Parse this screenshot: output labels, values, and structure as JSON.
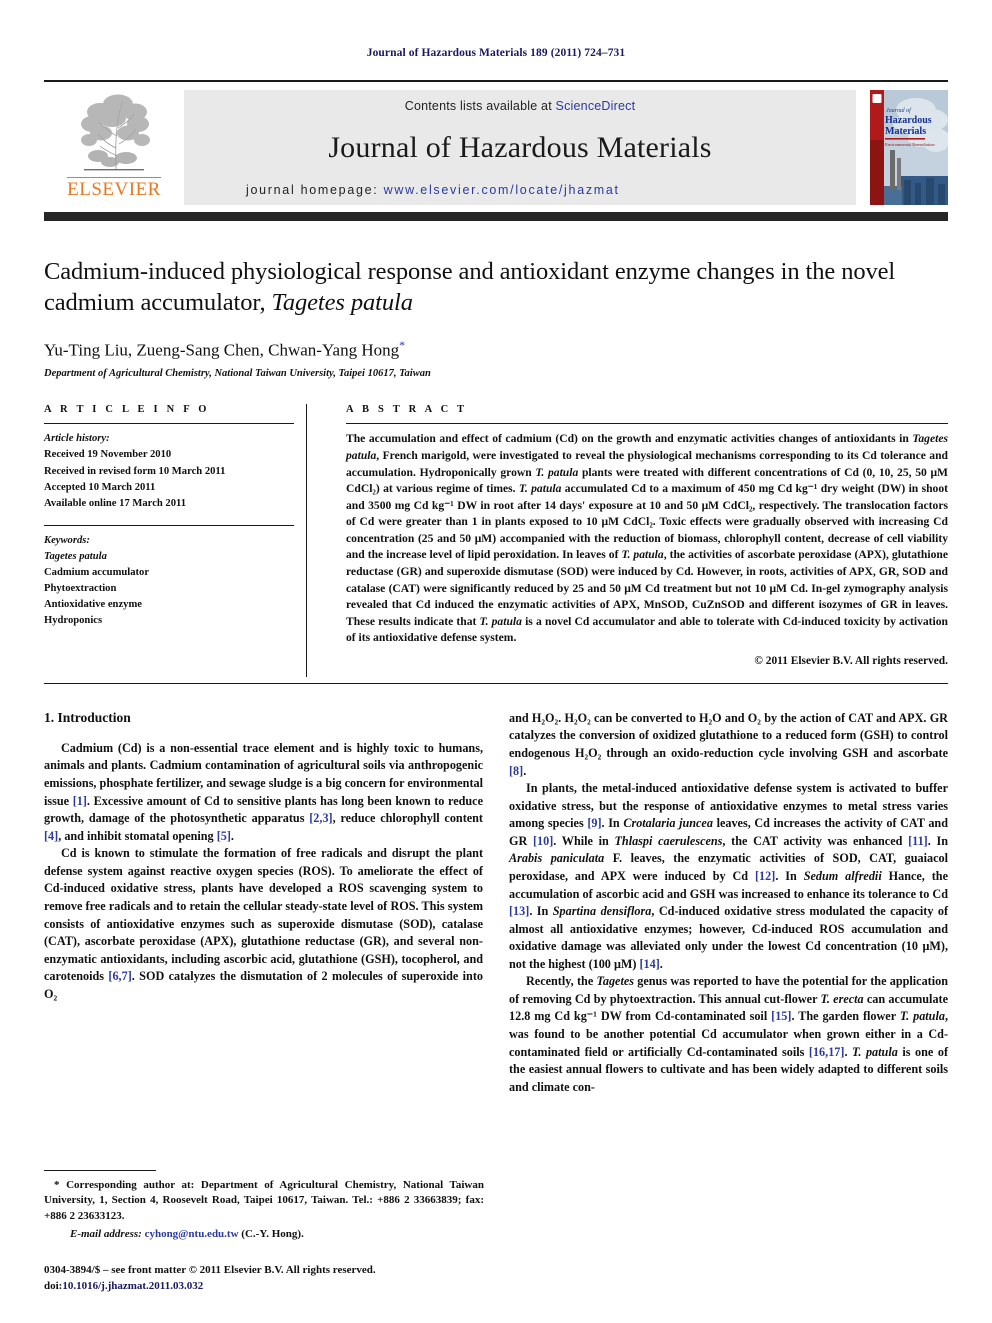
{
  "running_head": "Journal of Hazardous Materials 189 (2011) 724–731",
  "masthead": {
    "contents_prefix": "Contents lists available at ",
    "sciencedirect": "ScienceDirect",
    "journal_title": "Journal of Hazardous Materials",
    "homepage_prefix": "journal homepage: ",
    "homepage_url": "www.elsevier.com/locate/jhazmat",
    "publisher_logo_text": "ELSEVIER",
    "cover_title_line1": "Journal of",
    "cover_title_line2": "Hazardous",
    "cover_title_line3": "Materials",
    "link_color": "#2b3a9c",
    "logo_color": "#e87722"
  },
  "article": {
    "title_part1": "Cadmium-induced physiological response and antioxidant enzyme changes in the novel cadmium accumulator, ",
    "title_italic": "Tagetes patula",
    "authors": "Yu-Ting Liu, Zueng-Sang Chen, Chwan-Yang Hong",
    "author_marker": "*",
    "affiliation": "Department of Agricultural Chemistry, National Taiwan University, Taipei 10617, Taiwan"
  },
  "article_info": {
    "heading": "A R T I C L E  I N F O",
    "history_label": "Article history:",
    "history": [
      "Received 19 November 2010",
      "Received in revised form 10 March 2011",
      "Accepted 10 March 2011",
      "Available online 17 March 2011"
    ],
    "keywords_label": "Keywords:",
    "keywords": [
      "Tagetes patula",
      "Cadmium accumulator",
      "Phytoextraction",
      "Antioxidative enzyme",
      "Hydroponics"
    ]
  },
  "abstract": {
    "heading": "A B S T R A C T",
    "p1_a": "The accumulation and effect of cadmium (Cd) on the growth and enzymatic activities changes of antioxidants in ",
    "p1_i1": "Tagetes patula",
    "p1_b": ", French marigold, were investigated to reveal the physiological mechanisms corresponding to its Cd tolerance and accumulation. Hydroponically grown ",
    "p1_i2": "T. patula",
    "p1_c": " plants were treated with different concentrations of Cd (0, 10, 25, 50 μM CdCl₂) at various regime of times. ",
    "p1_i3": "T. patula",
    "p1_d": " accumulated Cd to a maximum of 450 mg Cd kg⁻¹ dry weight (DW) in shoot and 3500 mg Cd kg⁻¹ DW in root after 14 days' exposure at 10 and 50 μM CdCl₂, respectively. The translocation factors of Cd were greater than 1 in plants exposed to 10 μM CdCl₂. Toxic effects were gradually observed with increasing Cd concentration (25 and 50 μM) accompanied with the reduction of biomass, chlorophyll content, decrease of cell viability and the increase level of lipid peroxidation. In leaves of ",
    "p1_i4": "T. patula",
    "p1_e": ", the activities of ascorbate peroxidase (APX), glutathione reductase (GR) and superoxide dismutase (SOD) were induced by Cd. However, in roots, activities of APX, GR, SOD and catalase (CAT) were significantly reduced by 25 and 50 μM Cd treatment but not 10 μM Cd. In-gel zymography analysis revealed that Cd induced the enzymatic activities of APX, MnSOD, CuZnSOD and different isozymes of GR in leaves. These results indicate that ",
    "p1_i5": "T. patula",
    "p1_f": " is a novel Cd accumulator and able to tolerate with Cd-induced toxicity by activation of its antioxidative defense system.",
    "copyright": "© 2011 Elsevier B.V. All rights reserved."
  },
  "body": {
    "section_heading": "1. Introduction",
    "left_p1_a": "Cadmium (Cd) is a non-essential trace element and is highly toxic to humans, animals and plants. Cadmium contamination of agricultural soils via anthropogenic emissions, phosphate fertilizer, and sewage sludge is a big concern for environmental issue ",
    "left_p1_r1": "[1]",
    "left_p1_b": ". Excessive amount of Cd to sensitive plants has long been known to reduce growth, damage of the photosynthetic apparatus ",
    "left_p1_r2": "[2,3]",
    "left_p1_c": ", reduce chlorophyll content ",
    "left_p1_r3": "[4]",
    "left_p1_d": ", and inhibit stomatal opening ",
    "left_p1_r4": "[5]",
    "left_p1_e": ".",
    "left_p2_a": "Cd is known to stimulate the formation of free radicals and disrupt the plant defense system against reactive oxygen species (ROS). To ameliorate the effect of Cd-induced oxidative stress, plants have developed a ROS scavenging system to remove free radicals and to retain the cellular steady-state level of ROS. This system consists of antioxidative enzymes such as superoxide dismutase (SOD), catalase (CAT), ascorbate peroxidase (APX), glutathione reductase (GR), and several non-enzymatic antioxidants, including ascorbic acid, glutathione (GSH), tocopherol, and carotenoids ",
    "left_p2_r1": "[6,7]",
    "left_p2_b": ". SOD catalyzes the dismutation of 2 molecules of superoxide into O₂",
    "right_p1_a": "and H₂O₂. H₂O₂ can be converted to H₂O and O₂ by the action of CAT and APX. GR catalyzes the conversion of oxidized glutathione to a reduced form (GSH) to control endogenous H₂O₂ through an oxido-reduction cycle involving GSH and ascorbate ",
    "right_p1_r1": "[8]",
    "right_p1_b": ".",
    "right_p2_a": "In plants, the metal-induced antioxidative defense system is activated to buffer oxidative stress, but the response of antioxidative enzymes to metal stress varies among species ",
    "right_p2_r1": "[9]",
    "right_p2_b": ". In ",
    "right_p2_i1": "Crotalaria juncea",
    "right_p2_c": " leaves, Cd increases the activity of CAT and GR ",
    "right_p2_r2": "[10]",
    "right_p2_d": ". While in ",
    "right_p2_i2": "Thlaspi caerulescens",
    "right_p2_e": ", the CAT activity was enhanced ",
    "right_p2_r3": "[11]",
    "right_p2_f": ". In ",
    "right_p2_i3": "Arabis paniculata",
    "right_p2_g": " F. leaves, the enzymatic activities of SOD, CAT, guaiacol peroxidase, and APX were induced by Cd ",
    "right_p2_r4": "[12]",
    "right_p2_h": ". In ",
    "right_p2_i4": "Sedum alfredii",
    "right_p2_j": " Hance, the accumulation of ascorbic acid and GSH was increased to enhance its tolerance to Cd ",
    "right_p2_r5": "[13]",
    "right_p2_k": ". In ",
    "right_p2_i5": "Spartina densiflora",
    "right_p2_l": ", Cd-induced oxidative stress modulated the capacity of almost all antioxidative enzymes; however, Cd-induced ROS accumulation and oxidative damage was alleviated only under the lowest Cd concentration (10 μM), not the highest (100 μM) ",
    "right_p2_r6": "[14]",
    "right_p2_m": ".",
    "right_p3_a": "Recently, the ",
    "right_p3_i1": "Tagetes",
    "right_p3_b": " genus was reported to have the potential for the application of removing Cd by phytoextraction. This annual cut-flower ",
    "right_p3_i2": "T. erecta",
    "right_p3_c": " can accumulate 12.8 mg Cd kg⁻¹ DW from Cd-contaminated soil ",
    "right_p3_r1": "[15]",
    "right_p3_d": ". The garden flower ",
    "right_p3_i3": "T. patula",
    "right_p3_e": ", was found to be another potential Cd accumulator when grown either in a Cd-contaminated field or artificially Cd-contaminated soils ",
    "right_p3_r2": "[16,17]",
    "right_p3_f": ". ",
    "right_p3_i4": "T. patula",
    "right_p3_g": " is one of the easiest annual flowers to cultivate and has been widely adapted to different soils and climate con-"
  },
  "footnote": {
    "corresponding": "* Corresponding author at: Department of Agricultural Chemistry, National Taiwan University, 1, Section 4, Roosevelt Road, Taipei 10617, Taiwan. Tel.: +886 2 33663839; fax: +886 2 23633123.",
    "email_label": "E-mail address:",
    "email": "cyhong@ntu.edu.tw",
    "email_suffix": " (C.-Y. Hong).",
    "issn_line": "0304-3894/$ – see front matter © 2011 Elsevier B.V. All rights reserved.",
    "doi_label": "doi:",
    "doi": "10.1016/j.jhazmat.2011.03.032"
  }
}
